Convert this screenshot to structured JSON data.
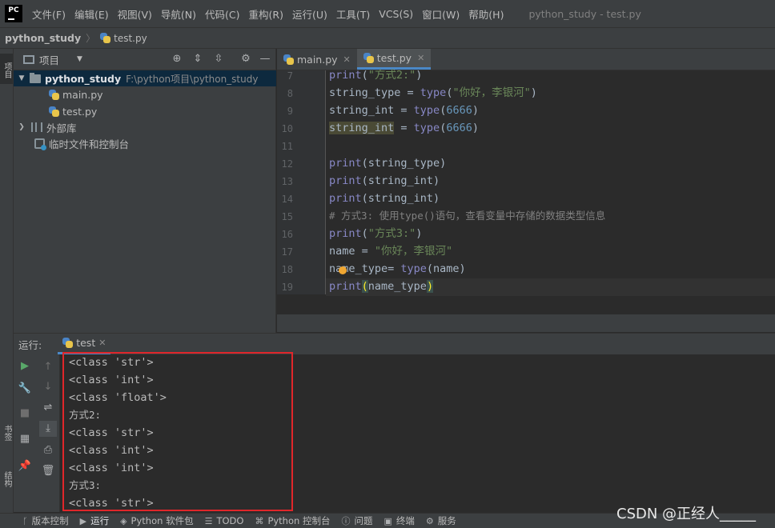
{
  "app": {
    "logo_text": "PC",
    "window_title": "python_study - test.py"
  },
  "menu": [
    "文件(F)",
    "编辑(E)",
    "视图(V)",
    "导航(N)",
    "代码(C)",
    "重构(R)",
    "运行(U)",
    "工具(T)",
    "VCS(S)",
    "窗口(W)",
    "帮助(H)"
  ],
  "breadcrumb": {
    "project": "python_study",
    "separator": "〉",
    "file": "test.py"
  },
  "left_strip": {
    "project": "项目",
    "bookmarks": "书签",
    "structure": "结构"
  },
  "project_panel": {
    "title": "项目",
    "root_name": "python_study",
    "root_path": "F:\\python项目\\python_study",
    "files": [
      "main.py",
      "test.py"
    ],
    "external_libs": "外部库",
    "scratches": "临时文件和控制台"
  },
  "editor": {
    "tabs": [
      {
        "label": "main.py",
        "active": false
      },
      {
        "label": "test.py",
        "active": true
      }
    ],
    "line_numbers": [
      "7",
      "8",
      "9",
      "10",
      "11",
      "12",
      "13",
      "14",
      "15",
      "16",
      "17",
      "18",
      "19"
    ],
    "code": {
      "l7": {
        "fn": "print",
        "a": "(",
        "s": "\"方式2:\"",
        "b": ")"
      },
      "l8": {
        "v": "string_type = ",
        "fn": "type",
        "a": "(",
        "s": "\"你好，李银河\"",
        "b": ")"
      },
      "l9": {
        "v": "string_int = ",
        "fn": "type",
        "a": "(",
        "n": "6666",
        "b": ")"
      },
      "l10": {
        "hv": "string_int",
        "v": " = ",
        "fn": "type",
        "a": "(",
        "n": "6666",
        "b": ")"
      },
      "l12": {
        "fn": "print",
        "r": "(string_type)"
      },
      "l13": {
        "fn": "print",
        "r": "(string_int)"
      },
      "l14": {
        "fn": "print",
        "r": "(string_int)"
      },
      "l15": {
        "c": "# 方式3: 使用type()语句，查看变量中存储的数据类型信息"
      },
      "l16": {
        "fn": "print",
        "a": "(",
        "s": "\"方式3:\"",
        "b": ")"
      },
      "l17": {
        "v": "name = ",
        "s": "\"你好，李银河\""
      },
      "l18": {
        "v": "name_type= ",
        "fn": "type",
        "r": "(name)"
      },
      "l19": {
        "fn": "print",
        "p1": "(",
        "r": "name_type",
        "p2": ")"
      }
    }
  },
  "run_panel": {
    "label": "运行:",
    "tab": "test",
    "output": [
      "<class 'str'>",
      "<class 'int'>",
      "<class 'float'>",
      "方式2:",
      "<class 'str'>",
      "<class 'int'>",
      "<class 'int'>",
      "方式3:",
      "<class 'str'>"
    ]
  },
  "bottom_bar": [
    {
      "icon": "branch-icon",
      "label": "版本控制",
      "glyph": "ᚴ"
    },
    {
      "icon": "run-icon",
      "label": "运行",
      "glyph": "▶"
    },
    {
      "icon": "packages-icon",
      "label": "Python 软件包",
      "glyph": "◈"
    },
    {
      "icon": "todo-icon",
      "label": "TODO",
      "glyph": "☰"
    },
    {
      "icon": "console-icon",
      "label": "Python 控制台",
      "glyph": "⌘"
    },
    {
      "icon": "problems-icon",
      "label": "问题",
      "glyph": "ⓘ"
    },
    {
      "icon": "terminal-icon",
      "label": "终端",
      "glyph": "▣"
    },
    {
      "icon": "services-icon",
      "label": "服务",
      "glyph": "⚙"
    }
  ],
  "watermark": "CSDN @正经人_____",
  "colors": {
    "background": "#2b2b2b",
    "panel": "#3c3f41",
    "keyword": "#8888c6",
    "string": "#6a8759",
    "number": "#6897bb",
    "comment": "#808080",
    "highlight_frame": "#e0262a",
    "selection": "#0d293e"
  }
}
